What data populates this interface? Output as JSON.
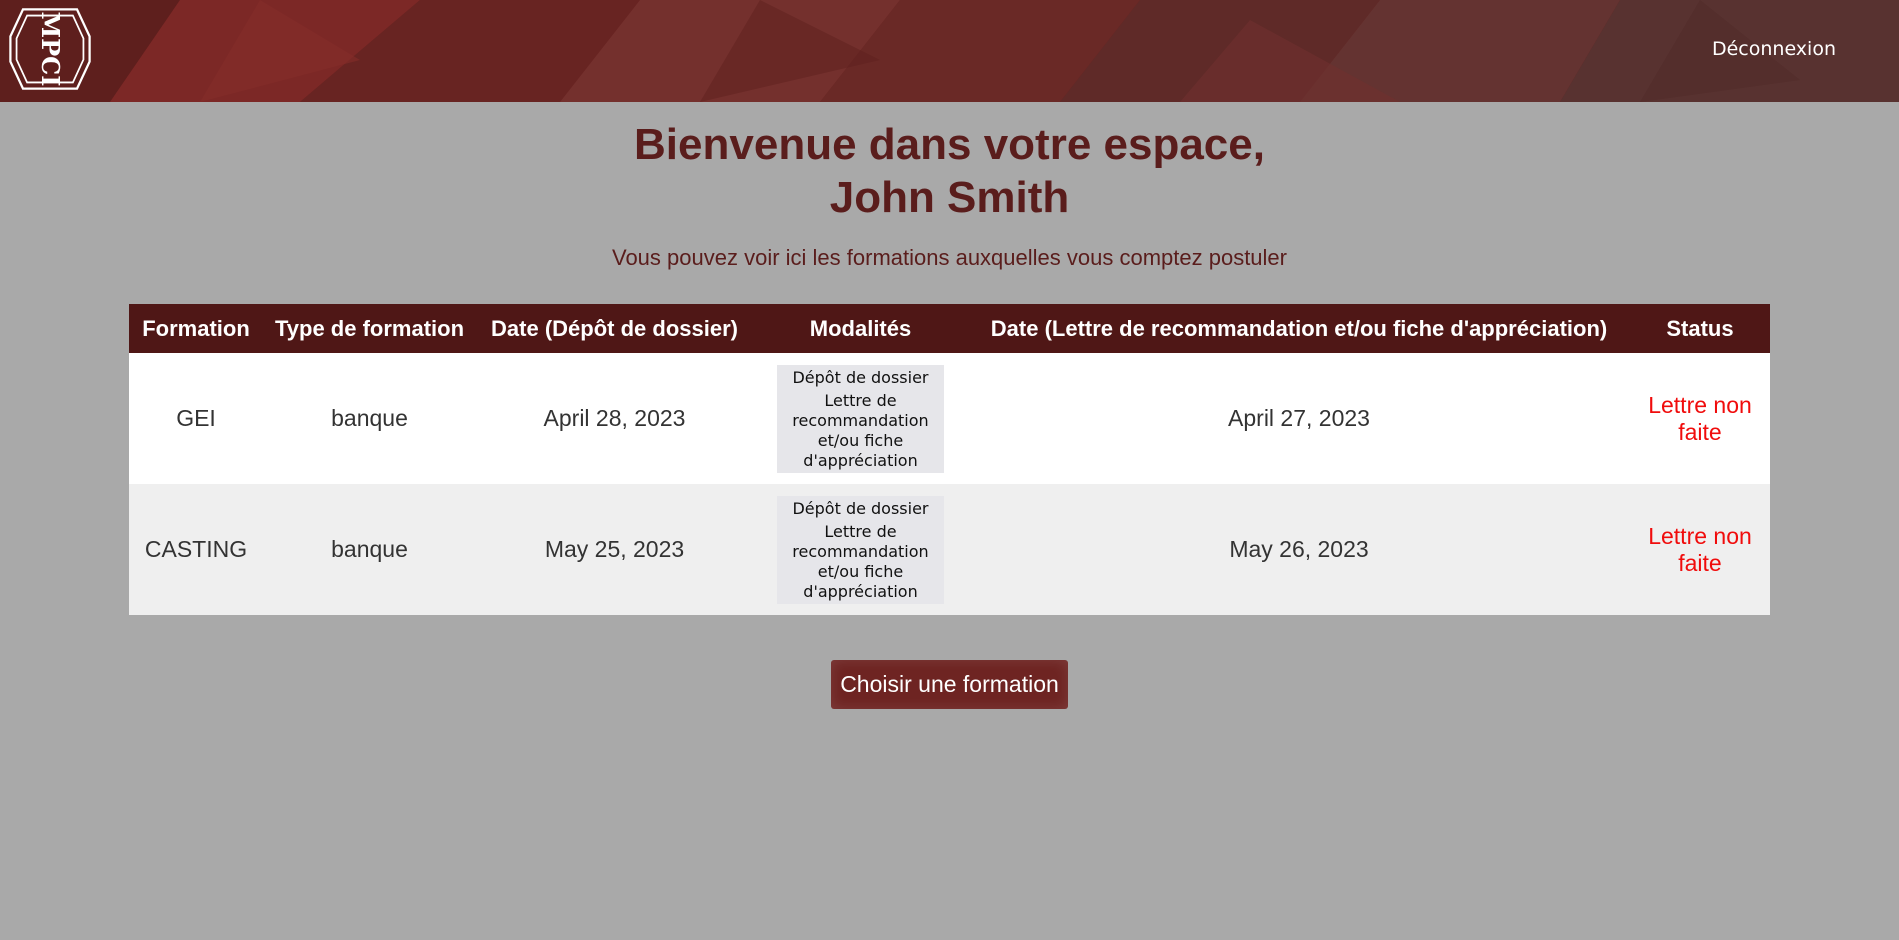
{
  "header": {
    "logo_text": "MPCI",
    "logout_label": "Déconnexion"
  },
  "welcome": {
    "line1": "Bienvenue dans votre espace,",
    "line2": "John Smith",
    "subtitle": "Vous pouvez voir ici les formations auxquelles vous comptez postuler"
  },
  "table": {
    "headers": [
      "Formation",
      "Type de formation",
      "Date (Dépôt de dossier)",
      "Modalités",
      "Date (Lettre de recommandation et/ou fiche d'appréciation)",
      "Status"
    ],
    "rows": [
      {
        "formation": "GEI",
        "type": "banque",
        "date_depot": "April 28, 2023",
        "modalite_1": "Dépôt de dossier",
        "modalite_2": "Lettre de recommandation et/ou fiche d'appréciation",
        "date_lettre": "April 27, 2023",
        "status": "Lettre non faite"
      },
      {
        "formation": "CASTING",
        "type": "banque",
        "date_depot": "May 25, 2023",
        "modalite_1": "Dépôt de dossier",
        "modalite_2": "Lettre de recommandation et/ou fiche d'appréciation",
        "date_lettre": "May 26, 2023",
        "status": "Lettre non faite"
      }
    ]
  },
  "actions": {
    "choose_label": "Choisir une formation"
  },
  "colors": {
    "header_bg": "#6e2422",
    "page_bg": "#a9a9a9",
    "title": "#5a1d1c",
    "table_header": "#4f1716",
    "status": "#f00c0c"
  }
}
